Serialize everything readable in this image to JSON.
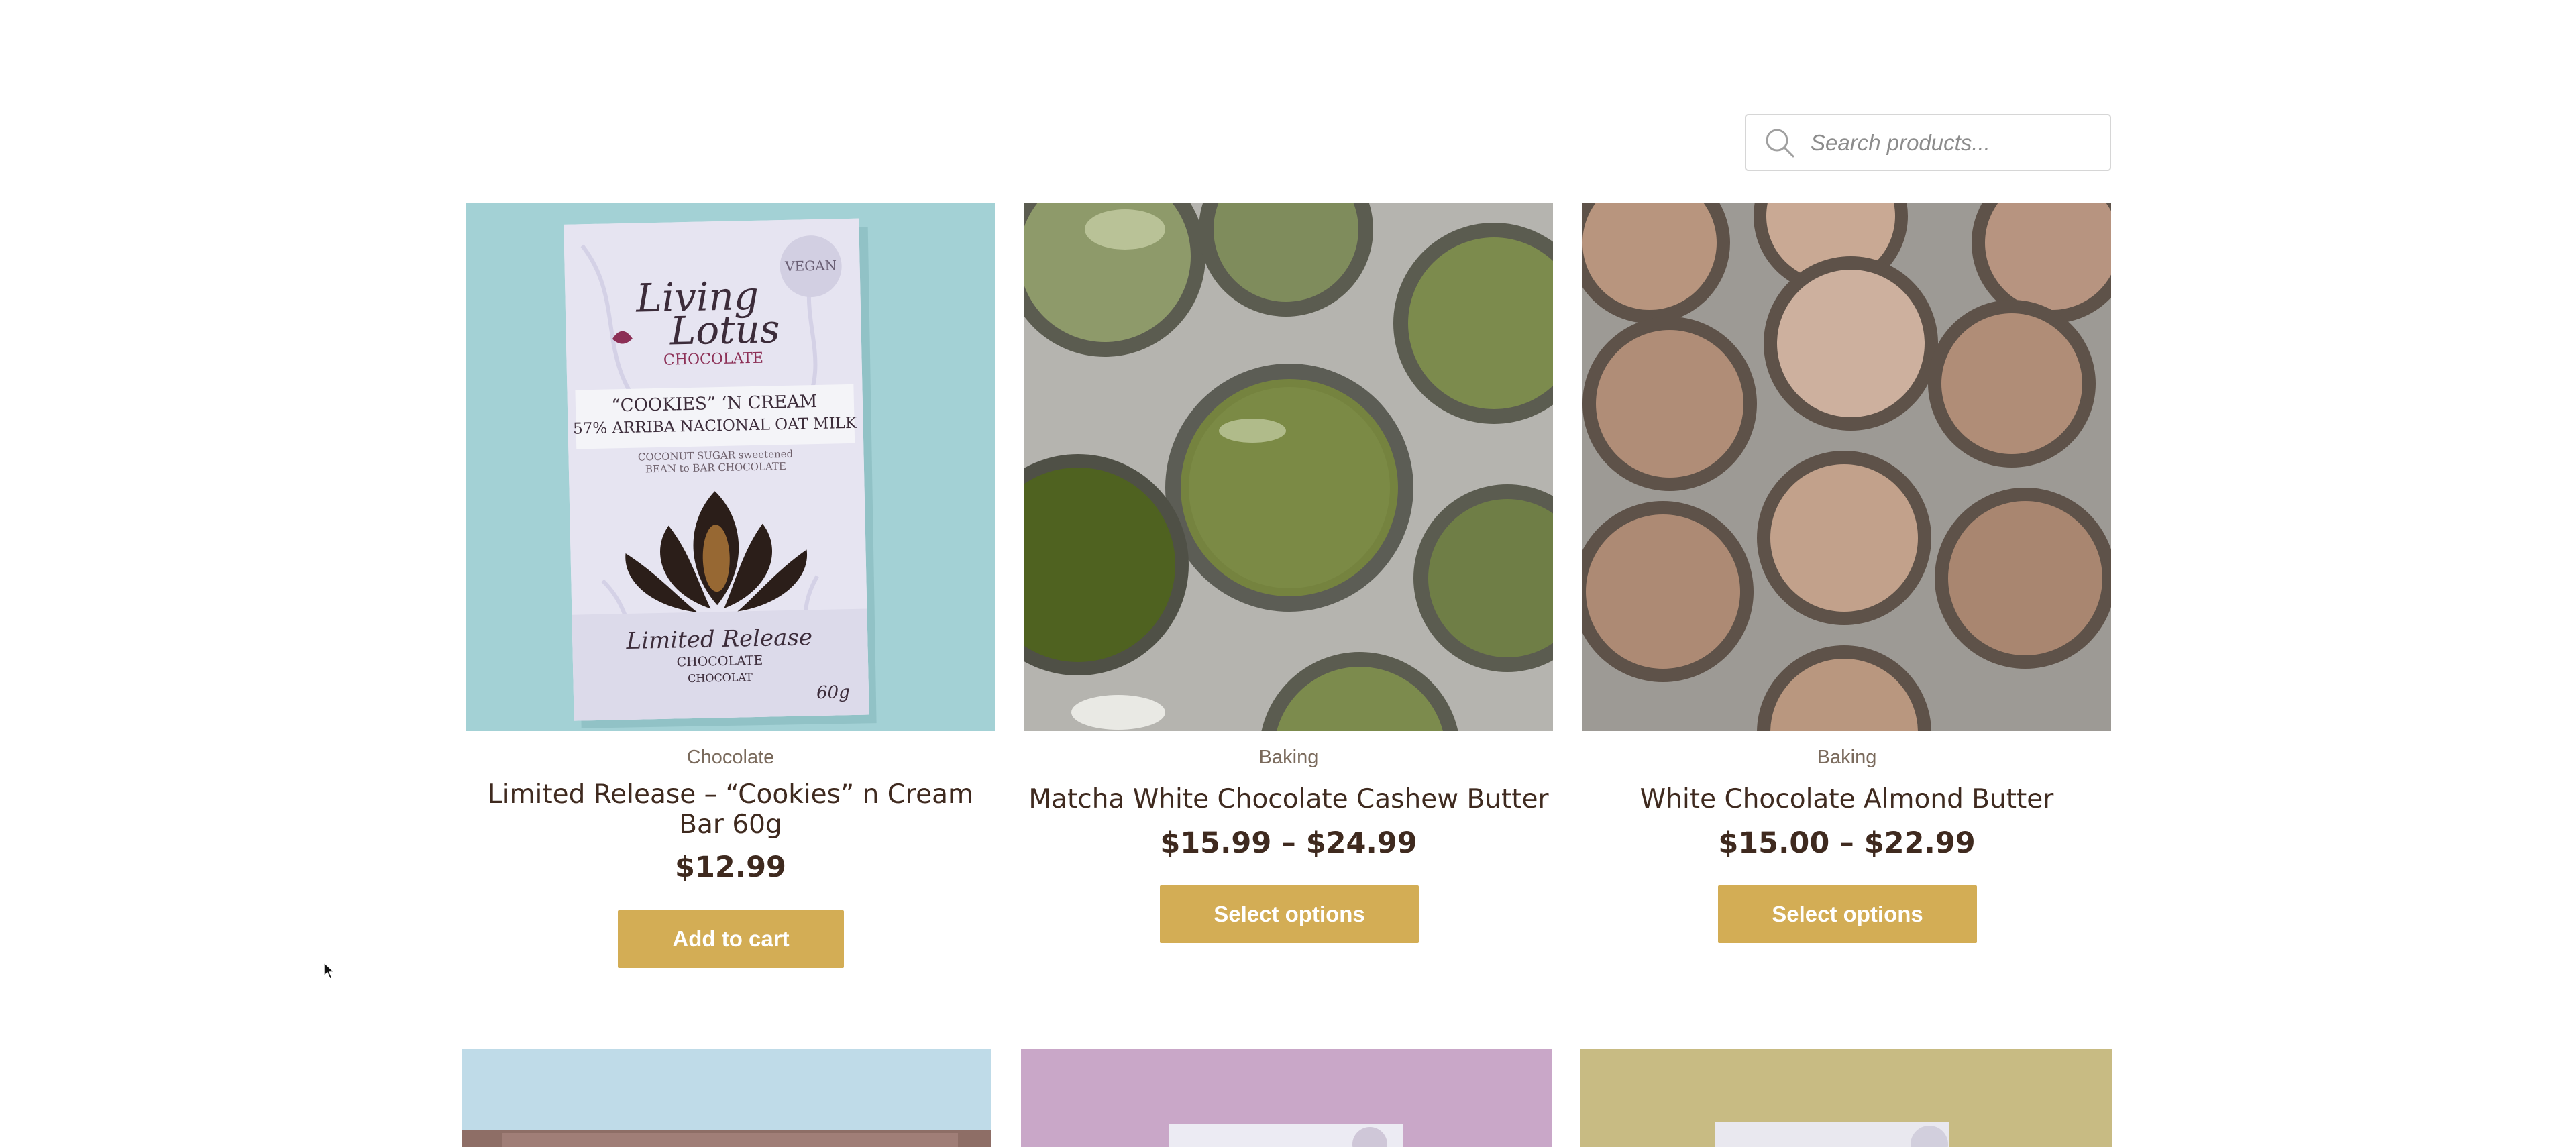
{
  "search": {
    "placeholder": "Search products..."
  },
  "products": [
    {
      "category": "Chocolate",
      "title": "Limited Release – “Cookies” n Cream Bar 60g",
      "price": "$12.99",
      "button": "Add to cart",
      "package": {
        "badge": "VEGAN",
        "brand_line1": "Living",
        "brand_line2": "Lotus",
        "brand_sub": "CHOCOLATE",
        "flavor": "“COOKIES” ‘N CREAM",
        "flavor_sub": "57% ARRIBA NACIONAL OAT MILK",
        "desc1": "COCONUT SUGAR sweetened",
        "desc2": "BEAN to BAR CHOCOLATE",
        "limited": "Limited Release",
        "choc1": "CHOCOLATE",
        "choc2": "CHOCOLAT",
        "weight": "60g"
      }
    },
    {
      "category": "Baking",
      "title": "Matcha White Chocolate Cashew Butter",
      "price": "$15.99 – $24.99",
      "button": "Select options"
    },
    {
      "category": "Baking",
      "title": "White Chocolate Almond Butter",
      "price": "$15.00 – $22.99",
      "button": "Select options"
    }
  ],
  "colors": {
    "button": "#d3ad55",
    "title": "#3f2a1f",
    "category": "#7a6a5c"
  }
}
